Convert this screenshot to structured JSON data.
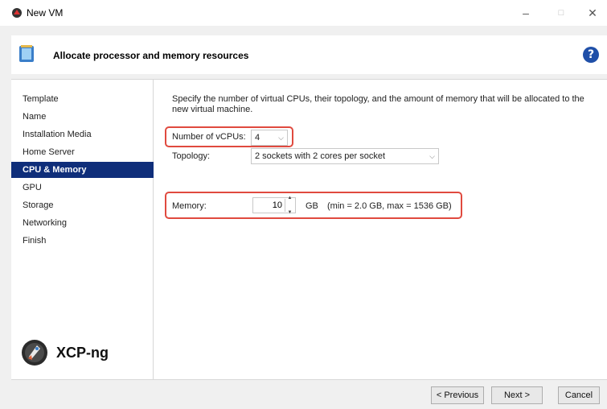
{
  "window": {
    "title": "New VM",
    "minimize_glyph": "–",
    "maximize_glyph": "□",
    "close_glyph": "✕"
  },
  "header": {
    "title": "Allocate processor and memory resources",
    "help_glyph": "?"
  },
  "sidebar": {
    "items": [
      {
        "label": "Template",
        "active": false
      },
      {
        "label": "Name",
        "active": false
      },
      {
        "label": "Installation Media",
        "active": false
      },
      {
        "label": "Home Server",
        "active": false
      },
      {
        "label": "CPU & Memory",
        "active": true
      },
      {
        "label": "GPU",
        "active": false
      },
      {
        "label": "Storage",
        "active": false
      },
      {
        "label": "Networking",
        "active": false
      },
      {
        "label": "Finish",
        "active": false
      }
    ],
    "logo_text": "XCP-ng"
  },
  "content": {
    "description": "Specify the number of virtual CPUs, their topology, and the amount of memory that will be allocated to the new virtual machine.",
    "vcpus": {
      "label": "Number of vCPUs:",
      "value": "4"
    },
    "topology": {
      "label": "Topology:",
      "value": "2 sockets with 2 cores per socket"
    },
    "memory": {
      "label": "Memory:",
      "value": "10",
      "unit": "GB",
      "range": "(min = 2.0 GB, max = 1536 GB)"
    }
  },
  "footer": {
    "previous": "< Previous",
    "next": "Next >",
    "cancel": "Cancel"
  },
  "colors": {
    "accent": "#0f2e7a",
    "highlight": "#e04a3f",
    "help": "#1f4fa8"
  },
  "icons": [
    "app-icon",
    "wizard-icon",
    "help-icon",
    "xcp-ng-logo",
    "spinner-arrows-icon",
    "chevron-down-icon"
  ]
}
